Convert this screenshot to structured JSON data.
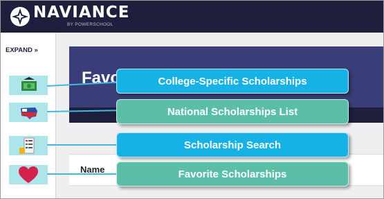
{
  "header": {
    "brand": "NAVIANCE",
    "brand_sub": "BY POWERSCHOOL",
    "logo_icon": "compass-star-icon",
    "bg_color": "#1d1f3c"
  },
  "sidebar": {
    "expand_label": "EXPAND »",
    "items": [
      {
        "icon": "college-money-icon"
      },
      {
        "icon": "us-flag-map-icon"
      },
      {
        "icon": "scholarship-list-icon"
      },
      {
        "icon": "heart-icon"
      }
    ],
    "highlight_color": "#aee5ea"
  },
  "main": {
    "title": "Favorite Scholarships",
    "table": {
      "columns": [
        "Name"
      ]
    }
  },
  "callouts": [
    {
      "label": "College-Specific Scholarships",
      "color": "#16b2e6"
    },
    {
      "label": "National Scholarships List",
      "color": "#5bbfa8"
    },
    {
      "label": "Scholarship Search",
      "color": "#16b2e6"
    },
    {
      "label": "Favorite Scholarships",
      "color": "#5bbfa8"
    }
  ]
}
